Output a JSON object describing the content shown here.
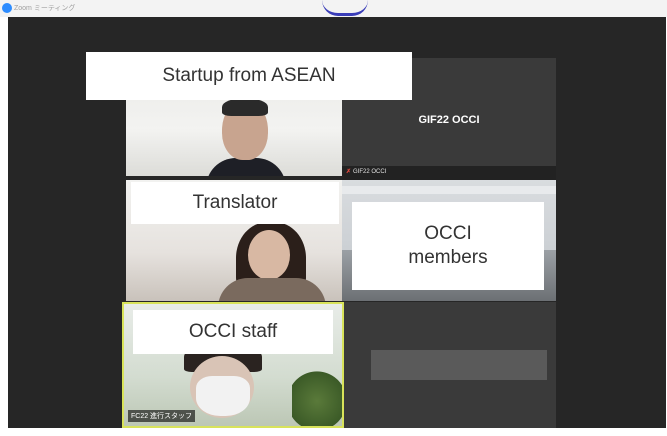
{
  "window": {
    "title": "Zoom ミーティング",
    "accent_color": "#2d8cff"
  },
  "labels": {
    "startup": "Startup from ASEAN",
    "translator": "Translator",
    "members_line1": "OCCI",
    "members_line2": "members",
    "staff": "OCCI staff"
  },
  "channel": {
    "name": "GIF22 OCCI",
    "tag": "GIF22 OCCI"
  },
  "participants": {
    "staff_nametag": "FC22 進行スタッフ"
  },
  "colors": {
    "stage_background": "#262626",
    "active_speaker_border": "#d8e35a",
    "label_background": "#ffffff",
    "label_text": "#333333"
  }
}
